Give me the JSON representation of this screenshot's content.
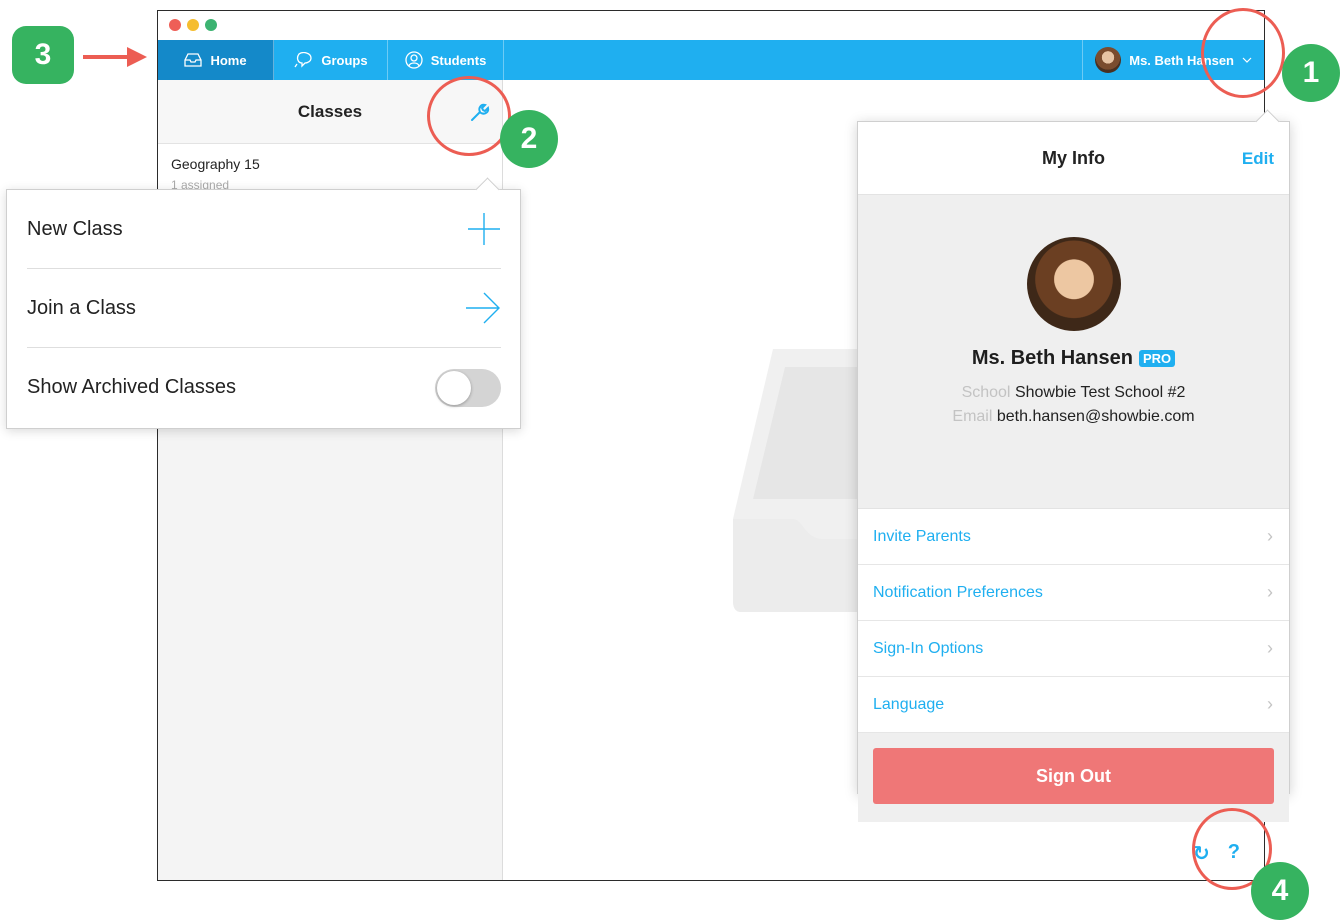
{
  "nav": {
    "tabs": [
      {
        "label": "Home"
      },
      {
        "label": "Groups"
      },
      {
        "label": "Students"
      }
    ],
    "user_name": "Ms. Beth Hansen"
  },
  "sidebar": {
    "title": "Classes",
    "classes": [
      {
        "name": "Geography 15",
        "sub": "1 assigned"
      }
    ]
  },
  "class_menu": {
    "items": [
      {
        "label": "New Class"
      },
      {
        "label": "Join a Class"
      },
      {
        "label": "Show Archived Classes"
      }
    ],
    "archived_toggle": false
  },
  "my_info": {
    "title": "My Info",
    "edit_label": "Edit",
    "name": "Ms. Beth Hansen",
    "badge": "PRO",
    "school_label": "School",
    "school": "Showbie Test School #2",
    "email_label": "Email",
    "email": "beth.hansen@showbie.com",
    "menu": [
      {
        "label": "Invite Parents"
      },
      {
        "label": "Notification Preferences"
      },
      {
        "label": "Sign-In Options"
      },
      {
        "label": "Language"
      }
    ],
    "sign_out": "Sign Out"
  },
  "footer": {
    "refresh_glyph": "↻",
    "help_glyph": "?"
  },
  "annotations": {
    "markers": [
      "1",
      "2",
      "3",
      "4"
    ]
  },
  "colors": {
    "accent": "#1faff0",
    "nav_active": "#1489c9",
    "sign_out": "#ef7777",
    "marker": "#36b360",
    "ring": "#ec5d53"
  }
}
